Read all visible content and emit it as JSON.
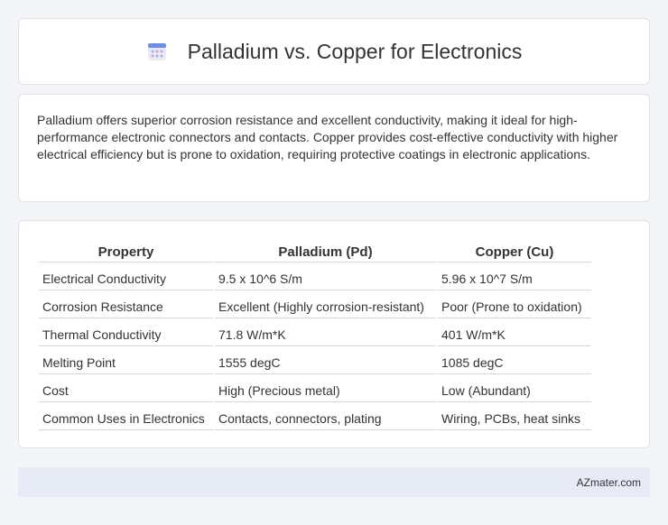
{
  "header": {
    "title": "Palladium vs. Copper for Electronics",
    "icon": "calendar-grid-icon",
    "icon_colors": {
      "top": "#6a8fe8",
      "body": "#e8ebf5",
      "dots": "#b9a7e6"
    }
  },
  "intro": {
    "text": "Palladium offers superior corrosion resistance and excellent conductivity, making it ideal for high-performance electronic connectors and contacts. Copper provides cost-effective conductivity with higher electrical efficiency but is prone to oxidation, requiring protective coatings in electronic applications."
  },
  "table": {
    "headers": [
      "Property",
      "Palladium (Pd)",
      "Copper (Cu)"
    ],
    "rows": [
      [
        "Electrical Conductivity",
        "9.5 x 10^6 S/m",
        "5.96 x 10^7 S/m"
      ],
      [
        "Corrosion Resistance",
        "Excellent (Highly corrosion-resistant)",
        "Poor (Prone to oxidation)"
      ],
      [
        "Thermal Conductivity",
        "71.8 W/m*K",
        "401 W/m*K"
      ],
      [
        "Melting Point",
        "1555 degC",
        "1085 degC"
      ],
      [
        "Cost",
        "High (Precious metal)",
        "Low (Abundant)"
      ],
      [
        "Common Uses in Electronics",
        "Contacts, connectors, plating",
        "Wiring, PCBs, heat sinks"
      ]
    ]
  },
  "footer": {
    "brand": "AZmater.com"
  }
}
